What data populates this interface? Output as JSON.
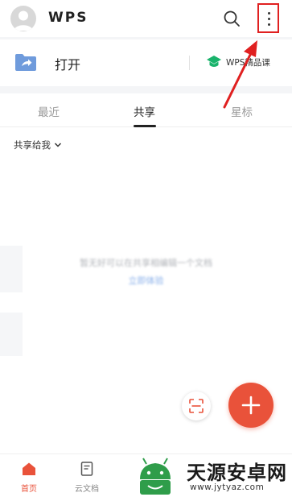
{
  "header": {
    "logo": "WPS",
    "icons": [
      "avatar",
      "search-icon",
      "more-vertical-icon"
    ]
  },
  "quick": {
    "open_label": "打开",
    "course_label": "WPS精品课"
  },
  "tabs": [
    {
      "label": "最近",
      "active": false
    },
    {
      "label": "共享",
      "active": true
    },
    {
      "label": "星标",
      "active": false
    }
  ],
  "filter": {
    "label": "共享给我"
  },
  "empty": {
    "message": "暂无好可以在共享相编辑一个文档",
    "link": "立即体验"
  },
  "bottom_nav": [
    {
      "label": "首页",
      "icon": "home-icon",
      "active": true
    },
    {
      "label": "云文档",
      "icon": "document-icon",
      "active": false
    }
  ],
  "watermark": {
    "title": "天源安卓网",
    "url": "www.jytyaz.com"
  },
  "colors": {
    "accent": "#e9523a",
    "highlight_box": "#e02020",
    "course_green": "#19b36b",
    "folder_blue": "#6f9bdc"
  }
}
